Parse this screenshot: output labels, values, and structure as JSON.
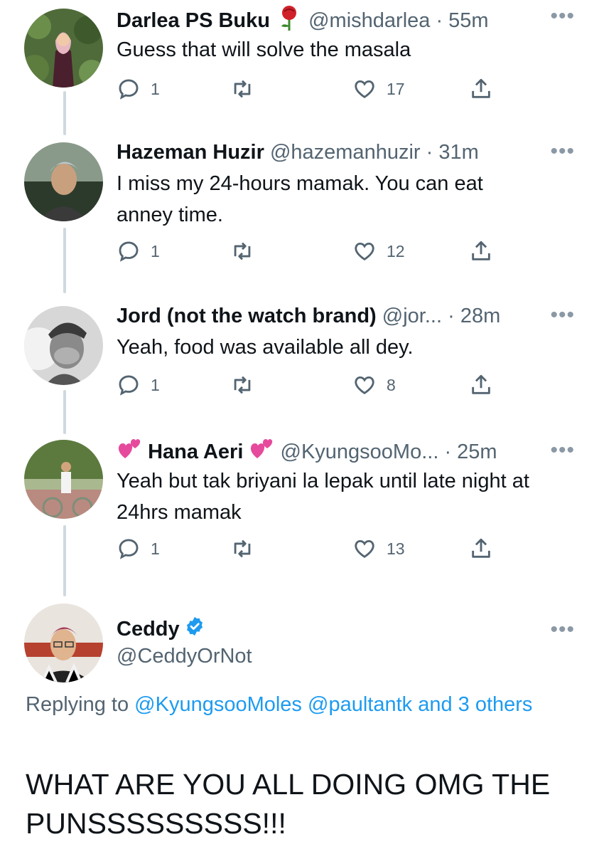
{
  "tweets": [
    {
      "name": "Darlea PS Buku",
      "emoji": "rose",
      "handle": "@mishdarlea",
      "time": "55m",
      "text": "Guess that will solve the masala",
      "replies": "1",
      "likes": "17"
    },
    {
      "name": "Hazeman Huzir",
      "handle": "@hazemanhuzir",
      "time": "31m",
      "text": "I miss my 24-hours mamak. You can eat anney time.",
      "replies": "1",
      "likes": "12"
    },
    {
      "name": "Jord (not the watch brand)",
      "handle": "@jor...",
      "time": "28m",
      "text": "Yeah, food was available all dey.",
      "replies": "1",
      "likes": "8"
    },
    {
      "name": "Hana Aeri",
      "emoji": "two-hearts",
      "handle": "@KyungsooMo...",
      "time": "25m",
      "text": "Yeah but tak briyani la lepak until late night at 24hrs mamak",
      "replies": "1",
      "likes": "13"
    }
  ],
  "main": {
    "name": "Ceddy",
    "handle": "@CeddyOrNot",
    "replying_prefix": "Replying to ",
    "reply_mention_1": "@KyungsooMoles",
    "reply_mention_2": "@paultantk",
    "reply_others": "and 3 others",
    "text": "WHAT ARE YOU ALL DOING OMG THE PUNSSSSSSSSS!!!"
  },
  "separator": " · ",
  "more_label": "•••",
  "colors": {
    "link": "#1d9bf0",
    "secondary": "#536471",
    "line": "#cfd9de",
    "verified": "#1d9bf0"
  }
}
